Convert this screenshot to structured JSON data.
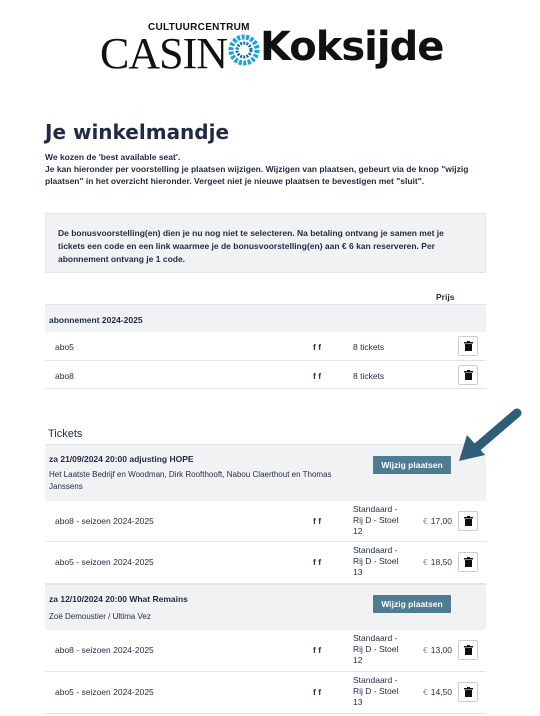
{
  "logo": {
    "small": "CULTUURCENTRUM",
    "casino": "CASIN",
    "koksijde": "Koksijde"
  },
  "page_title": "Je winkelmandje",
  "intro": {
    "line1": "We kozen de 'best available seat'.",
    "line2": "Je kan hieronder per voorstelling je plaatsen wijzigen. Wijzigen van plaatsen, gebeurt via de knop \"wijzig plaatsen\" in het overzicht hieronder. Vergeet niet je nieuwe plaatsen te bevestigen met \"sluit\"."
  },
  "info": "De bonusvoorstelling(en) dien je nu nog niet te selecteren. Na betaling ontvang je samen met je tickets een code en een link waarmee je de bonusvoorstelling(en) aan € 6 kan reserveren. Per abonnement ontvang je 1 code.",
  "table_header": {
    "prijs": "Prijs"
  },
  "abonnement": {
    "title": "abonnement 2024-2025",
    "rows": [
      {
        "name": "abo5",
        "ff": "f f",
        "count": "8 tickets"
      },
      {
        "name": "abo8",
        "ff": "f f",
        "count": "8 tickets"
      }
    ]
  },
  "tickets_title": "Tickets",
  "events": [
    {
      "title": "za 21/09/2024 20:00 adjusting HOPE",
      "artists": "Het Laatste Bedrijf en Woodman, Dirk Roofthooft, Nabou Claerthout en Thomas Janssens",
      "button": "Wijzig plaatsen",
      "rows": [
        {
          "name": "abo8 - seizoen 2024-2025",
          "ff": "f f",
          "seat1": "Standaard -",
          "seat2": "Rij D - Stoel",
          "seat3": "12",
          "currency": "€",
          "price": "17,00"
        },
        {
          "name": "abo5 - seizoen 2024-2025",
          "ff": "f f",
          "seat1": "Standaard -",
          "seat2": "Rij D - Stoel",
          "seat3": "13",
          "currency": "€",
          "price": "18,50"
        }
      ]
    },
    {
      "title": "za 12/10/2024 20:00 What Remains",
      "artists": "Zoë Demoustier / Ultima Vez",
      "button": "Wijzig plaatsen",
      "rows": [
        {
          "name": "abo8 - seizoen 2024-2025",
          "ff": "f f",
          "seat1": "Standaard -",
          "seat2": "Rij D - Stoel",
          "seat3": "12",
          "currency": "€",
          "price": "13,00"
        },
        {
          "name": "abo5 - seizoen 2024-2025",
          "ff": "f f",
          "seat1": "Standaard -",
          "seat2": "Rij D - Stoel",
          "seat3": "13",
          "currency": "€",
          "price": "14,50"
        }
      ]
    }
  ],
  "icons": {
    "delete": "trash-icon",
    "logo_mark": "logo-o-icon",
    "pointer": "arrow-icon"
  },
  "colors": {
    "button": "#4e7d93",
    "arrow": "#2e5f79",
    "text": "#1f2a44",
    "panel": "#f1f2f4"
  }
}
